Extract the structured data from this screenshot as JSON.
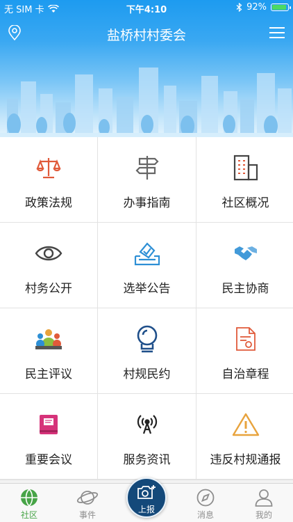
{
  "status_bar": {
    "carrier": "无 SIM 卡",
    "time": "下午4:10",
    "battery_text": "92%",
    "battery_level": 0.92
  },
  "header": {
    "title": "盐桥村村委会",
    "location_icon": "location-pin-icon",
    "menu_icon": "hamburger-menu-icon"
  },
  "grid": {
    "items": [
      {
        "label": "政策法规",
        "icon": "scales-icon",
        "color": "#e05a3a"
      },
      {
        "label": "办事指南",
        "icon": "signpost-icon",
        "color": "#666666"
      },
      {
        "label": "社区概况",
        "icon": "building-icon",
        "color": "#444444"
      },
      {
        "label": "村务公开",
        "icon": "eye-icon",
        "color": "#444444"
      },
      {
        "label": "选举公告",
        "icon": "ballot-box-icon",
        "color": "#2d8fd5"
      },
      {
        "label": "民主协商",
        "icon": "handshake-icon",
        "color": "#2d8fd5"
      },
      {
        "label": "民主评议",
        "icon": "group-discussion-icon",
        "color": "#e8a33d"
      },
      {
        "label": "村规民约",
        "icon": "lightbulb-icon",
        "color": "#1f4f8a"
      },
      {
        "label": "自治章程",
        "icon": "document-icon",
        "color": "#e05a3a"
      },
      {
        "label": "重要会议",
        "icon": "meeting-book-icon",
        "color": "#d6337a"
      },
      {
        "label": "服务资讯",
        "icon": "broadcast-antenna-icon",
        "color": "#333333"
      },
      {
        "label": "违反村规通报",
        "icon": "warning-triangle-icon",
        "color": "#e8a33d"
      }
    ]
  },
  "tabbar": {
    "tabs": [
      {
        "label": "社区",
        "icon": "globe-icon",
        "active": true
      },
      {
        "label": "事件",
        "icon": "planet-icon",
        "active": false
      },
      {
        "label": "消息",
        "icon": "compass-icon",
        "active": false
      },
      {
        "label": "我的",
        "icon": "person-icon",
        "active": false
      }
    ],
    "report_button": {
      "label": "上报",
      "icon": "camera-plus-icon"
    }
  },
  "colors": {
    "header_blue": "#1d9bf0",
    "active_tab": "#47a447",
    "fab_navy": "#14497a"
  }
}
